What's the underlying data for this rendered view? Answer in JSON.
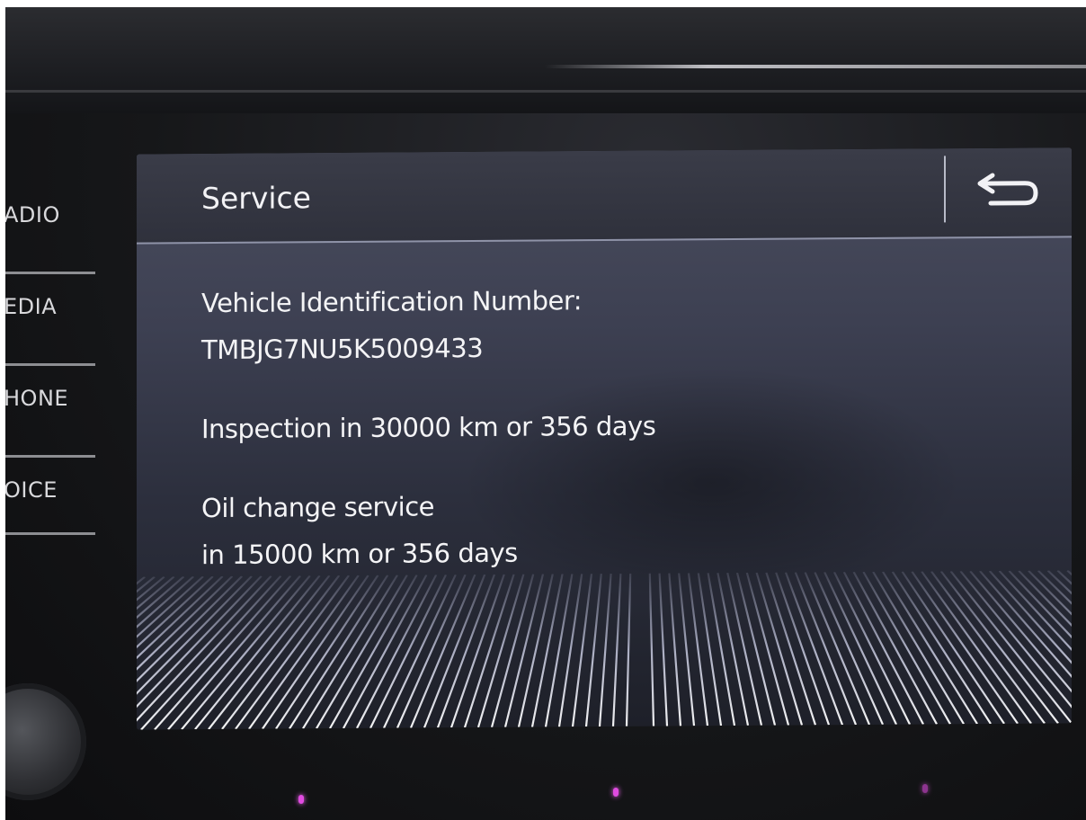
{
  "side_buttons": [
    {
      "label": "ADIO"
    },
    {
      "label": "EDIA"
    },
    {
      "label": "HONE"
    },
    {
      "label": "OICE"
    }
  ],
  "screen": {
    "title": "Service",
    "back_icon": "return-arrow-icon",
    "vin_label": "Vehicle Identification Number:",
    "vin_value": "TMBJG7NU5K5009433",
    "inspection": "Inspection in 30000 km or 356 days",
    "oil_line1": "Oil change service",
    "oil_line2": "in 15000 km or 356 days"
  },
  "colors": {
    "text": "#f4f4f6",
    "header_bg": "#2f313c",
    "header_underline": "#8f93a8",
    "led": "#e04be0"
  }
}
